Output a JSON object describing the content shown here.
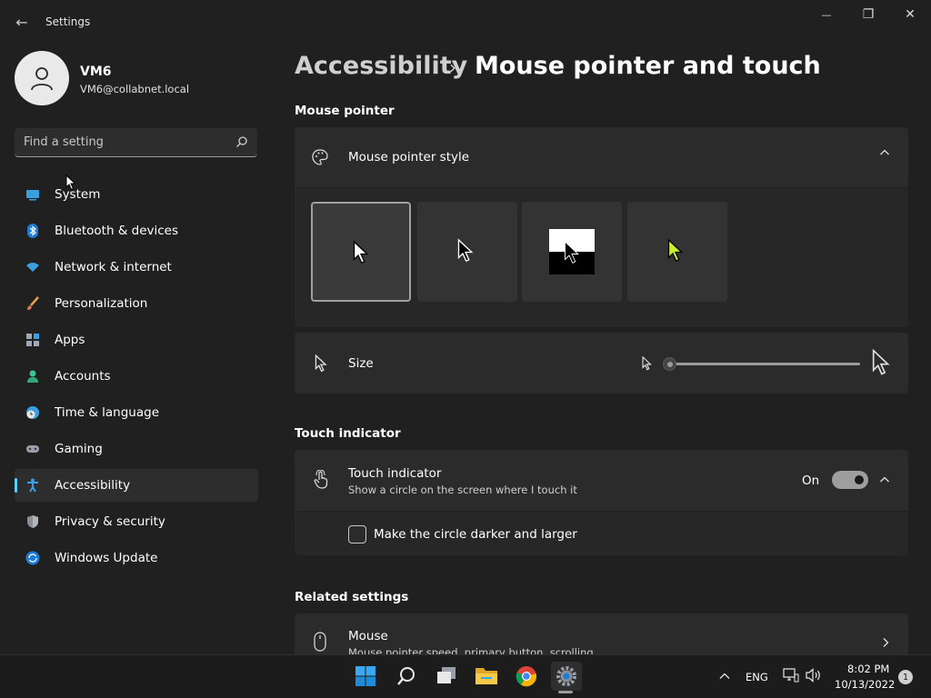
{
  "window": {
    "title": "Settings",
    "back_glyph": "←",
    "controls": {
      "minimize": "—",
      "maximize": "❐",
      "close": "✕"
    }
  },
  "profile": {
    "name": "VM6",
    "email": "VM6@collabnet.local"
  },
  "search": {
    "placeholder": "Find a setting"
  },
  "nav": {
    "items": [
      {
        "label": "System",
        "icon": "system-icon",
        "active": false
      },
      {
        "label": "Bluetooth & devices",
        "icon": "bluetooth-icon",
        "active": false
      },
      {
        "label": "Network & internet",
        "icon": "wifi-icon",
        "active": false
      },
      {
        "label": "Personalization",
        "icon": "brush-icon",
        "active": false
      },
      {
        "label": "Apps",
        "icon": "apps-icon",
        "active": false
      },
      {
        "label": "Accounts",
        "icon": "accounts-icon",
        "active": false
      },
      {
        "label": "Time & language",
        "icon": "clock-globe-icon",
        "active": false
      },
      {
        "label": "Gaming",
        "icon": "gamepad-icon",
        "active": false
      },
      {
        "label": "Accessibility",
        "icon": "accessibility-icon",
        "active": true
      },
      {
        "label": "Privacy & security",
        "icon": "shield-icon",
        "active": false
      },
      {
        "label": "Windows Update",
        "icon": "update-icon",
        "active": false
      }
    ]
  },
  "breadcrumb": {
    "parent": "Accessibility",
    "separator": "›",
    "current": "Mouse pointer and touch"
  },
  "mouse_pointer": {
    "section_title": "Mouse pointer",
    "style_label": "Mouse pointer style",
    "styles": [
      "white",
      "black",
      "inverted",
      "custom"
    ],
    "selected_style": "white",
    "custom_color": "#c8f02c",
    "size_label": "Size",
    "size_value": 0.0
  },
  "touch": {
    "section_title": "Touch indicator",
    "label": "Touch indicator",
    "description": "Show a circle on the screen where I touch it",
    "state_label": "On",
    "enabled": true,
    "darker_label": "Make the circle darker and larger",
    "darker_checked": false
  },
  "related": {
    "section_title": "Related settings",
    "mouse_label": "Mouse",
    "mouse_desc": "Mouse pointer speed, primary button, scrolling"
  },
  "taskbar": {
    "apps": [
      "start-icon",
      "search-icon",
      "task-view-icon",
      "file-explorer-icon",
      "chrome-icon",
      "settings-icon"
    ],
    "language": "ENG",
    "time": "8:02 PM",
    "date": "10/13/2022",
    "notification_count": "1"
  },
  "colors": {
    "accent": "#60cdff",
    "background": "#202020",
    "card": "#2b2b2b"
  }
}
